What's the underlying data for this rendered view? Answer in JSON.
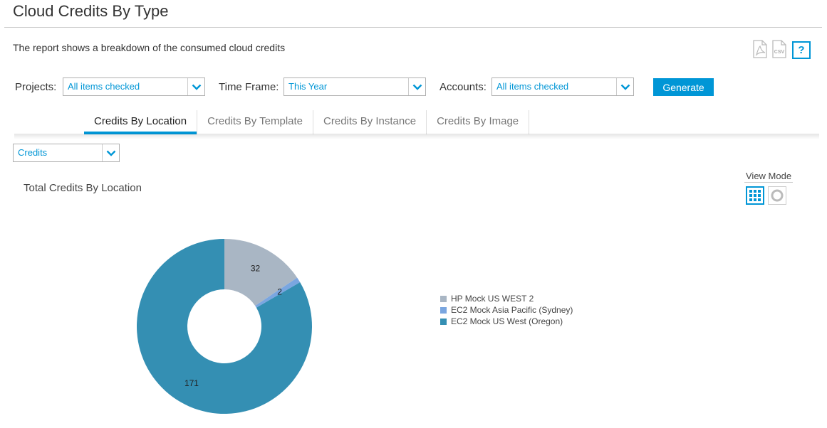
{
  "page": {
    "title": "Cloud Credits By Type",
    "description": "The report shows a breakdown of the consumed cloud credits"
  },
  "toolbar": {
    "icons": [
      "pdf-export-icon",
      "csv-export-icon"
    ],
    "csv_text": "CSV",
    "help_label": "?"
  },
  "filters": {
    "projects": {
      "label": "Projects:",
      "value": "All items checked"
    },
    "time_frame": {
      "label": "Time Frame:",
      "value": "This Year"
    },
    "accounts": {
      "label": "Accounts:",
      "value": "All items checked"
    },
    "generate_label": "Generate"
  },
  "tabs": [
    {
      "label": "Credits By Location",
      "active": true
    },
    {
      "label": "Credits By Template",
      "active": false
    },
    {
      "label": "Credits By Instance",
      "active": false
    },
    {
      "label": "Credits By Image",
      "active": false
    }
  ],
  "metric_select": {
    "value": "Credits"
  },
  "chart_section": {
    "title": "Total Credits By Location",
    "view_mode_label": "View Mode",
    "view_modes": [
      {
        "icon": "grid-view-icon",
        "active": true
      },
      {
        "icon": "donut-view-icon",
        "active": false
      }
    ]
  },
  "colors": {
    "accent": "#0096d6"
  },
  "chart_data": {
    "type": "pie",
    "style": "donut",
    "title": "",
    "legend_position": "right",
    "categories": [
      "HP Mock US WEST 2",
      "EC2 Mock Asia Pacific (Sydney)",
      "EC2 Mock US West (Oregon)"
    ],
    "values": [
      32,
      2,
      171
    ],
    "colors": [
      "#a9b6c4",
      "#7aa6e0",
      "#348fb3"
    ]
  }
}
